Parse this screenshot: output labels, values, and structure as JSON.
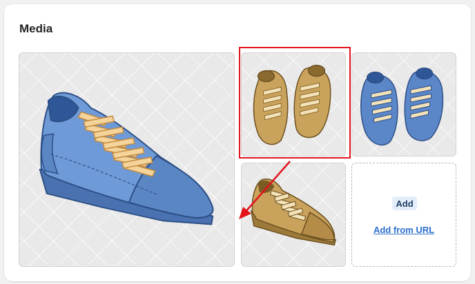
{
  "section": {
    "title": "Media"
  },
  "media_items": [
    {
      "name": "blue sneaker side view",
      "color": "#5b86c8"
    },
    {
      "name": "tan sneakers pair top view",
      "color": "#c9a35c"
    },
    {
      "name": "blue sneakers pair top view",
      "color": "#5b86c8"
    },
    {
      "name": "tan sneaker side view",
      "color": "#c9a35c"
    }
  ],
  "dropzone": {
    "add_label": "Add",
    "add_from_url_label": "Add from URL"
  },
  "annotation": {
    "highlight_color": "#e3121b",
    "arrow_color": "#e3121b"
  }
}
